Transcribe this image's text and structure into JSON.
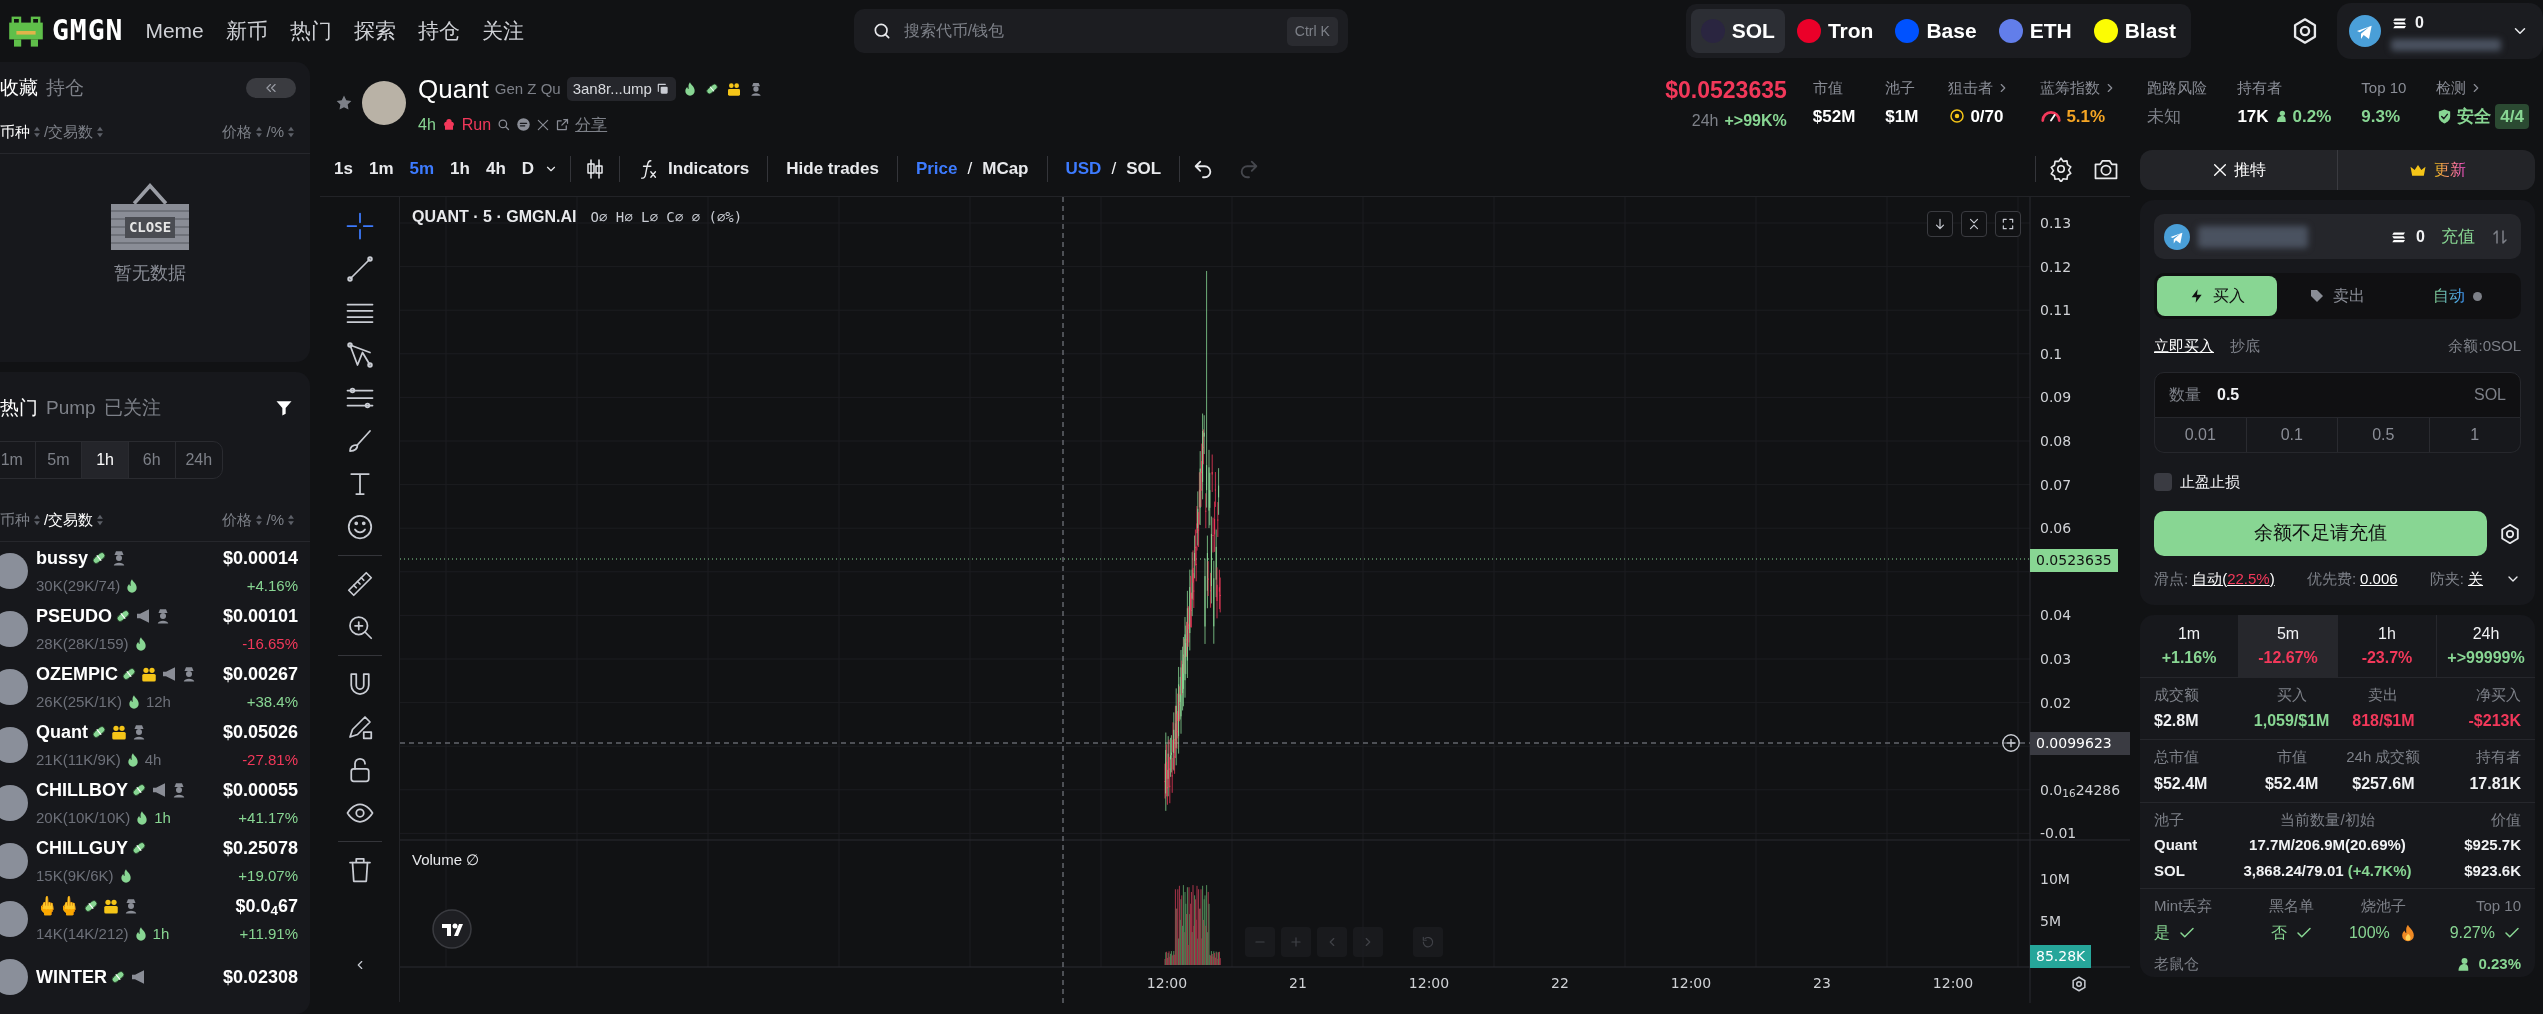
{
  "nav": {
    "logo": "GMGN",
    "links": [
      "Meme",
      "新币",
      "热门",
      "探索",
      "持仓",
      "关注"
    ]
  },
  "search": {
    "placeholder": "搜索代币/钱包",
    "shortcut": "Ctrl K"
  },
  "chains": [
    {
      "label": "SOL",
      "selected": true,
      "color": "#2a2540"
    },
    {
      "label": "Tron",
      "selected": false,
      "color": "#eb0029"
    },
    {
      "label": "Base",
      "selected": false,
      "color": "#0052ff"
    },
    {
      "label": "ETH",
      "selected": false,
      "color": "#627eea"
    },
    {
      "label": "Blast",
      "selected": false,
      "color": "#fcfc03"
    }
  ],
  "wallet": {
    "balance": "0"
  },
  "favorites": {
    "tabs": [
      {
        "label": "收藏",
        "selected": true
      },
      {
        "label": "持仓",
        "selected": false
      }
    ],
    "columns": [
      {
        "label": "币种",
        "selected": true
      },
      {
        "label": "/交易数",
        "selected": false
      }
    ],
    "right_columns": [
      "价格",
      "/%"
    ],
    "sign_text": "CLOSE",
    "empty_text": "暂无数据"
  },
  "trending": {
    "tabs": [
      {
        "label": "热门",
        "selected": true
      },
      {
        "label": "Pump",
        "selected": false
      },
      {
        "label": "已关注",
        "selected": false
      }
    ],
    "periods": [
      {
        "label": "1m",
        "selected": false
      },
      {
        "label": "5m",
        "selected": false
      },
      {
        "label": "1h",
        "selected": true
      },
      {
        "label": "6h",
        "selected": false
      },
      {
        "label": "24h",
        "selected": false
      }
    ],
    "columns": [
      {
        "label": "币种",
        "selected": false
      },
      {
        "label": "/交易数",
        "selected": true
      }
    ],
    "right_columns": [
      "价格",
      "/%"
    ],
    "rows": [
      {
        "name": "bussy",
        "badges": [
          {
            "kind": "pill"
          },
          {
            "kind": "dev"
          }
        ],
        "stats": "30K(29K/74)",
        "hot": true,
        "price": "$0.00014",
        "change": "+4.16%",
        "kind": "up"
      },
      {
        "name": "PSEUDO",
        "badges": [
          {
            "kind": "pill"
          },
          {
            "kind": "speaker"
          },
          {
            "kind": "dev"
          }
        ],
        "stats": "28K(28K/159)",
        "hot": true,
        "price": "$0.00101",
        "change": "-16.65%",
        "kind": "down"
      },
      {
        "name": "OZEMPIC",
        "badges": [
          {
            "kind": "pill"
          },
          {
            "kind": "group"
          },
          {
            "kind": "speaker"
          },
          {
            "kind": "dev"
          }
        ],
        "stats": "26K(25K/1K)",
        "hot": true,
        "age": "12h",
        "fresh": false,
        "price": "$0.00267",
        "change": "+38.4%",
        "kind": "up"
      },
      {
        "name": "Quant",
        "badges": [
          {
            "kind": "pill"
          },
          {
            "kind": "group"
          },
          {
            "kind": "dev"
          }
        ],
        "stats": "21K(11K/9K)",
        "hot": true,
        "age": "4h",
        "fresh": false,
        "price": "$0.05026",
        "change": "-27.81%",
        "kind": "down"
      },
      {
        "name": "CHILLBOY",
        "badges": [
          {
            "kind": "pill"
          },
          {
            "kind": "speaker"
          },
          {
            "kind": "dev"
          }
        ],
        "stats": "20K(10K/10K)",
        "hot": true,
        "age": "1h",
        "fresh": true,
        "price": "$0.00055",
        "change": "+41.17%",
        "kind": "up"
      },
      {
        "name": "CHILLGUY",
        "badges": [
          {
            "kind": "pill"
          }
        ],
        "stats": "15K(9K/6K)",
        "hot": true,
        "price": "$0.25078",
        "change": "+19.07%",
        "kind": "up"
      },
      {
        "name": "🖕🖕",
        "badges": [
          {
            "kind": "pill"
          },
          {
            "kind": "group"
          },
          {
            "kind": "dev"
          }
        ],
        "stats": "14K(14K/212)",
        "hot": true,
        "age": "1h",
        "fresh": true,
        "price": "$0.0$_{4}$67",
        "change": "+11.91%",
        "kind": "up"
      },
      {
        "name": "WINTER",
        "badges": [
          {
            "kind": "pill"
          },
          {
            "kind": "speaker"
          }
        ],
        "price": "$0.02308"
      }
    ]
  },
  "token": {
    "name": "Quant",
    "subtitle": "Gen Z Qu",
    "address": "3an8r...ump",
    "badges": [
      {
        "kind": "fire"
      },
      {
        "kind": "pill"
      },
      {
        "kind": "group"
      },
      {
        "kind": "dev"
      }
    ],
    "age": "4h",
    "tag": "Run",
    "share": "分享",
    "price": "$0.0523635",
    "change_period": "24h",
    "change": "+>99K%",
    "stats": [
      {
        "label": "市值",
        "value": "$52M",
        "kind": "plain",
        "more": false
      },
      {
        "label": "池子",
        "value": "$1M",
        "kind": "plain",
        "more": false
      },
      {
        "label": "狙击者",
        "value": "0/70",
        "kind": "sniper",
        "more": true
      },
      {
        "label": "蓝筹指数",
        "value": "5.1%",
        "kind": "gauge",
        "more": true
      },
      {
        "label": "跑路风险",
        "value": "未知",
        "kind": "muted",
        "more": false
      },
      {
        "label": "持有者",
        "value": "17K",
        "extra": "0.2%",
        "kind": "holders",
        "more": false
      },
      {
        "label": "Top 10",
        "value": "9.3%",
        "kind": "good",
        "more": false
      },
      {
        "label": "检测",
        "value": "安全",
        "extra": "4/4",
        "kind": "safe",
        "more": true
      }
    ]
  },
  "chart": {
    "intervals": [
      {
        "label": "1s",
        "selected": false
      },
      {
        "label": "1m",
        "selected": false
      },
      {
        "label": "5m",
        "selected": true
      },
      {
        "label": "1h",
        "selected": false
      },
      {
        "label": "4h",
        "selected": false
      },
      {
        "label": "D",
        "selected": false
      }
    ],
    "indicators": "Indicators",
    "hide_trades": "Hide trades",
    "divider_text": "/",
    "price_mode": [
      {
        "label": "Price",
        "selected": true
      },
      {
        "label": "MCap",
        "selected": false
      }
    ],
    "currency": [
      {
        "label": "USD",
        "selected": true
      },
      {
        "label": "SOL",
        "selected": false
      }
    ],
    "undo_disabled": false,
    "redo_disabled": true,
    "legend_title": "QUANT · 5 · GMGN.AI",
    "legend_values": "O∅ H∅ L∅ C∅ ∅ (∅%)",
    "price_axis": [
      "0.13",
      "0.12",
      "0.11",
      "0.1",
      "0.09",
      "0.08",
      "0.07",
      "0.06",
      "0.04",
      "0.03",
      "0.02",
      "0.0$_{16}$24286",
      "-0.01"
    ],
    "last_price": "0.0523635",
    "crosshair_price": "0.0099623",
    "volume_label": "Volume ∅",
    "volume_axis": [
      "10M",
      "5M"
    ],
    "last_volume": "85.28K",
    "time_axis": [
      "12:00",
      "21",
      "12:00",
      "22",
      "12:00",
      "23",
      "12:00"
    ]
  },
  "social": [
    {
      "label": "推特",
      "kind": "x"
    },
    {
      "label": "更新",
      "kind": "premium"
    }
  ],
  "trade": {
    "wallet_balance": "0",
    "deposit": "充值",
    "sides": [
      {
        "label": "买入",
        "selected": true,
        "kind": "buy"
      },
      {
        "label": "卖出",
        "selected": false,
        "kind": "sell"
      },
      {
        "label": "自动",
        "selected": false,
        "kind": "auto"
      }
    ],
    "modes": [
      {
        "label": "立即买入",
        "selected": true
      },
      {
        "label": "抄底",
        "selected": false
      }
    ],
    "balance": "余额:0SOL",
    "amount_label": "数量",
    "amount": "0.5",
    "unit": "SOL",
    "presets": [
      "0.01",
      "0.1",
      "0.5",
      "1"
    ],
    "tp_sl": {
      "label": "止盈止损",
      "checked": false
    },
    "submit": "余额不足请充值",
    "slippage": {
      "label": "滑点:",
      "parts": [
        {
          "text": "自动(",
          "kind": "plain"
        },
        {
          "text": "22.5%",
          "kind": "warn"
        },
        {
          "text": ")",
          "kind": "plain"
        }
      ]
    },
    "priority_fee": {
      "label": "优先费:",
      "value": "0.006"
    },
    "anti_mev": {
      "label": "防夹:",
      "value": "关"
    }
  },
  "stats": {
    "periods": [
      {
        "label": "1m",
        "change": "+1.16%",
        "kind": "up",
        "selected": false
      },
      {
        "label": "5m",
        "change": "-12.67%",
        "kind": "down",
        "selected": true
      },
      {
        "label": "1h",
        "change": "-23.7%",
        "kind": "down",
        "selected": false
      },
      {
        "label": "24h",
        "change": "+>99999%",
        "kind": "up",
        "selected": false
      }
    ],
    "rows": [
      [
        {
          "label": "成交额",
          "value": "$2.8M",
          "kind": "plain"
        },
        {
          "label": "买入",
          "value": "1,059/$1M",
          "kind": "up"
        },
        {
          "label": "卖出",
          "value": "818/$1M",
          "kind": "down"
        },
        {
          "label": "净买入",
          "value": "-$213K",
          "kind": "down"
        }
      ],
      [
        {
          "label": "总市值",
          "value": "$52.4M",
          "kind": "plain"
        },
        {
          "label": "市值",
          "value": "$52.4M",
          "kind": "plain"
        },
        {
          "label": "24h 成交额",
          "value": "$257.6M",
          "kind": "plain"
        },
        {
          "label": "持有者",
          "value": "17.81K",
          "kind": "plain"
        }
      ]
    ],
    "pool": {
      "columns": [
        "池子",
        "当前数量/初始",
        "价值"
      ],
      "rows": [
        {
          "token": "Quant",
          "amount": "17.7M/206.9M(20.69%)",
          "value": "$925.7K"
        },
        {
          "token": "SOL",
          "amount": "3,868.24/79.01",
          "delta": "(+4.7K%)",
          "value": "$923.6K"
        }
      ]
    },
    "safety": [
      {
        "label": "Mint丢弃",
        "value": "是",
        "kind": "check"
      },
      {
        "label": "黑名单",
        "value": "否",
        "kind": "check"
      },
      {
        "label": "烧池子",
        "value": "100%",
        "kind": "fire"
      },
      {
        "label": "Top 10",
        "value": "9.27%",
        "kind": "check"
      }
    ],
    "rat": {
      "label": "老鼠仓",
      "value": "0.23%"
    }
  }
}
